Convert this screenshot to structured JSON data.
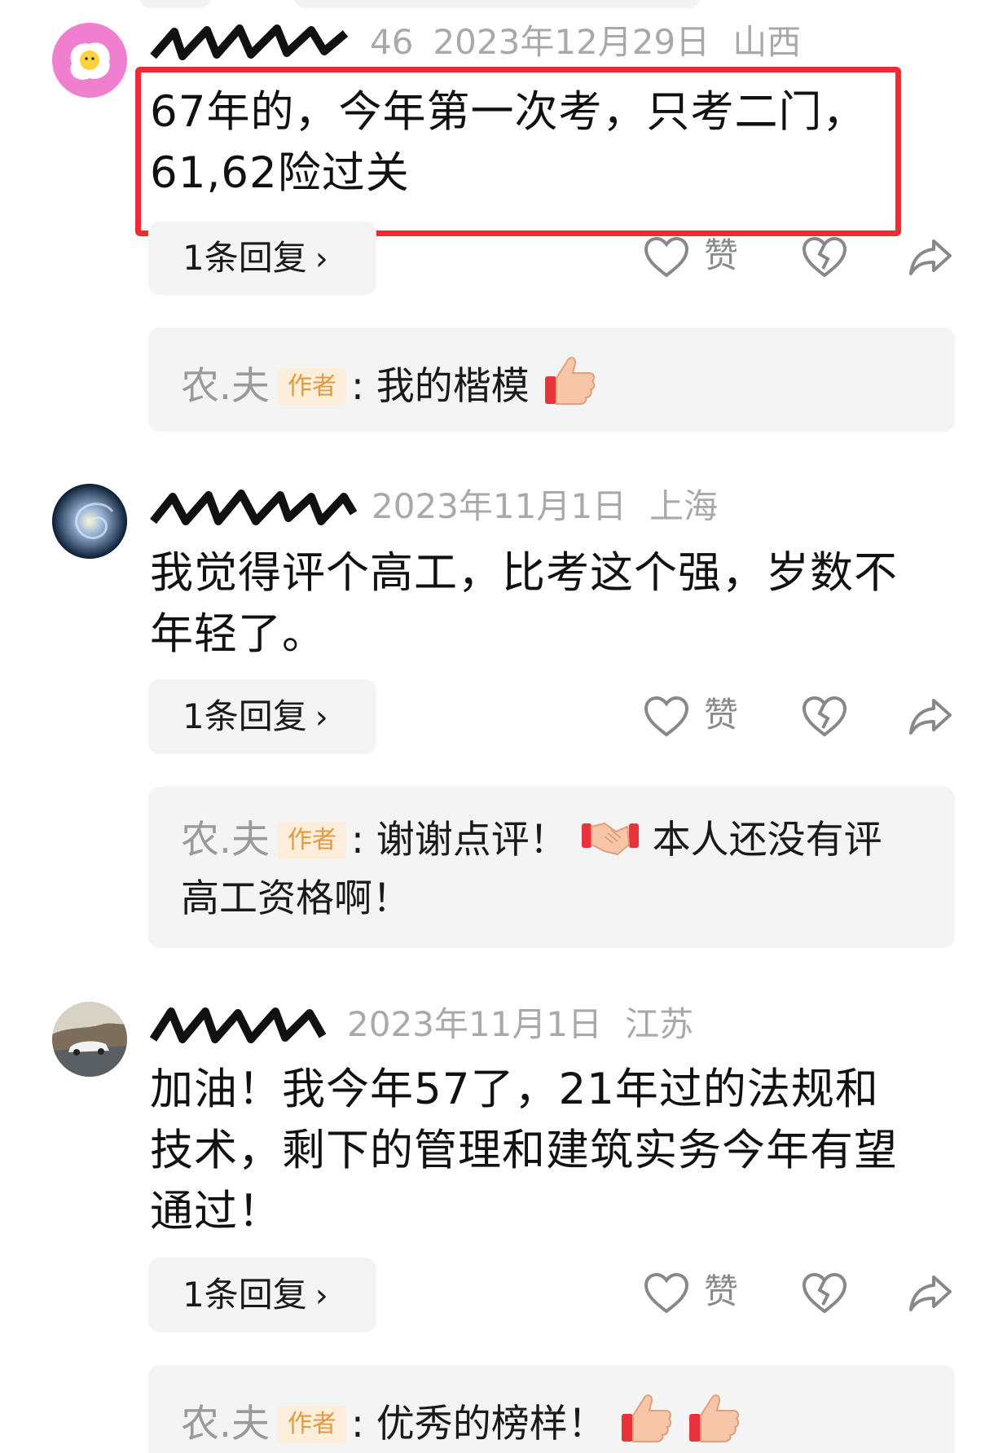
{
  "comments": [
    {
      "username_partial": "46",
      "date": "2023年12月29日",
      "location": "山西",
      "text": "67年的，今年第一次考，只考二门，61,62险过关",
      "text_line1": "67年的，今年第一次考，只考二门，",
      "text_line2": "61,62险过关",
      "reply_count_label": "1条回复",
      "like_label": "赞",
      "author_reply": {
        "name": "农.夫",
        "tag": "作者",
        "separator": ":",
        "text": "我的楷模",
        "emojis": [
          "thumbs-up-icon"
        ]
      }
    },
    {
      "username_partial": "",
      "date": "2023年11月1日",
      "location": "上海",
      "text_line1": "我觉得评个高工，比考这个强，岁数不",
      "text_line2": "年轻了。",
      "reply_count_label": "1条回复",
      "like_label": "赞",
      "author_reply": {
        "name": "农.夫",
        "tag": "作者",
        "separator": ":",
        "text_before": "谢谢点评！",
        "text_after": "本人还没有评",
        "text_line2": "高工资格啊！",
        "emojis": [
          "handshake-icon"
        ]
      }
    },
    {
      "username_partial": "",
      "date": "2023年11月1日",
      "location": "江苏",
      "text_line1": "加油！我今年57了，21年过的法规和",
      "text_line2": "技术，剩下的管理和建筑实务今年有望",
      "text_line3": "通过！",
      "reply_count_label": "1条回复",
      "like_label": "赞",
      "author_reply": {
        "name": "农.夫",
        "tag": "作者",
        "separator": ":",
        "text": "优秀的榜样！",
        "emojis": [
          "thumbs-up-icon",
          "thumbs-up-icon"
        ]
      }
    }
  ],
  "colors": {
    "highlight_border": "#ee2b35",
    "meta_gray": "#a9a9a9",
    "pill_bg": "#f4f4f4",
    "author_tag_bg": "#fdeedc",
    "author_tag_text": "#e39a3d"
  }
}
